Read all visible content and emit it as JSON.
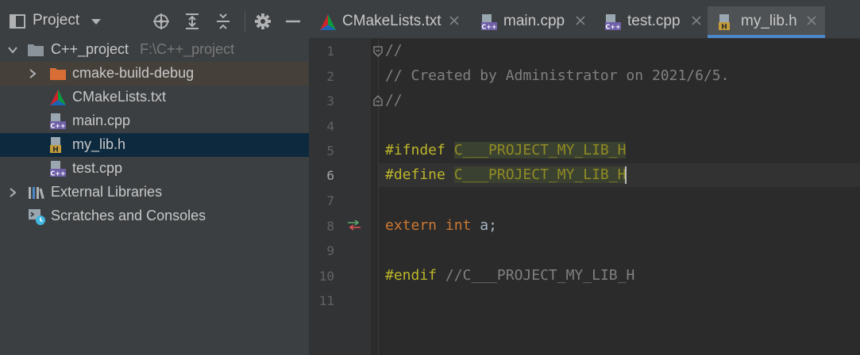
{
  "project_panel": {
    "title": "Project",
    "tree": [
      {
        "label": "C++_project",
        "hint": "F:\\C++_project"
      },
      {
        "label": "cmake-build-debug"
      },
      {
        "label": "CMakeLists.txt"
      },
      {
        "label": "main.cpp"
      },
      {
        "label": "my_lib.h"
      },
      {
        "label": "test.cpp"
      },
      {
        "label": "External Libraries"
      },
      {
        "label": "Scratches and Consoles"
      }
    ]
  },
  "editor": {
    "tabs": [
      {
        "label": "CMakeLists.txt"
      },
      {
        "label": "main.cpp"
      },
      {
        "label": "test.cpp"
      },
      {
        "label": "my_lib.h",
        "active": true
      }
    ],
    "line_numbers": [
      "1",
      "2",
      "3",
      "4",
      "5",
      "6",
      "7",
      "8",
      "9",
      "10",
      "11"
    ],
    "code": {
      "l1": "//",
      "l2": "// Created by Administrator on 2021/6/5.",
      "l3": "//",
      "l5_directive": "#ifndef",
      "l5_macro": "C___PROJECT_MY_LIB_H",
      "l6_directive": "#define",
      "l6_macro": "C___PROJECT_MY_LIB_",
      "l6_macro_end": "H",
      "l8_kw1": "extern",
      "l8_kw2": "int",
      "l8_rest": "a;",
      "l10_directive": "#endif",
      "l10_comment": "//C___PROJECT_MY_LIB_H"
    }
  },
  "icons": {
    "project": "project-view-icon",
    "locate": "locate-target-icon",
    "expand": "expand-all-icon",
    "collapse": "collapse-all-icon",
    "settings": "gear-icon",
    "hide": "minimize-icon"
  },
  "colors": {
    "accent": "#4a88c7",
    "selection": "#0d293e",
    "excluded_folder": "#d86e35"
  }
}
